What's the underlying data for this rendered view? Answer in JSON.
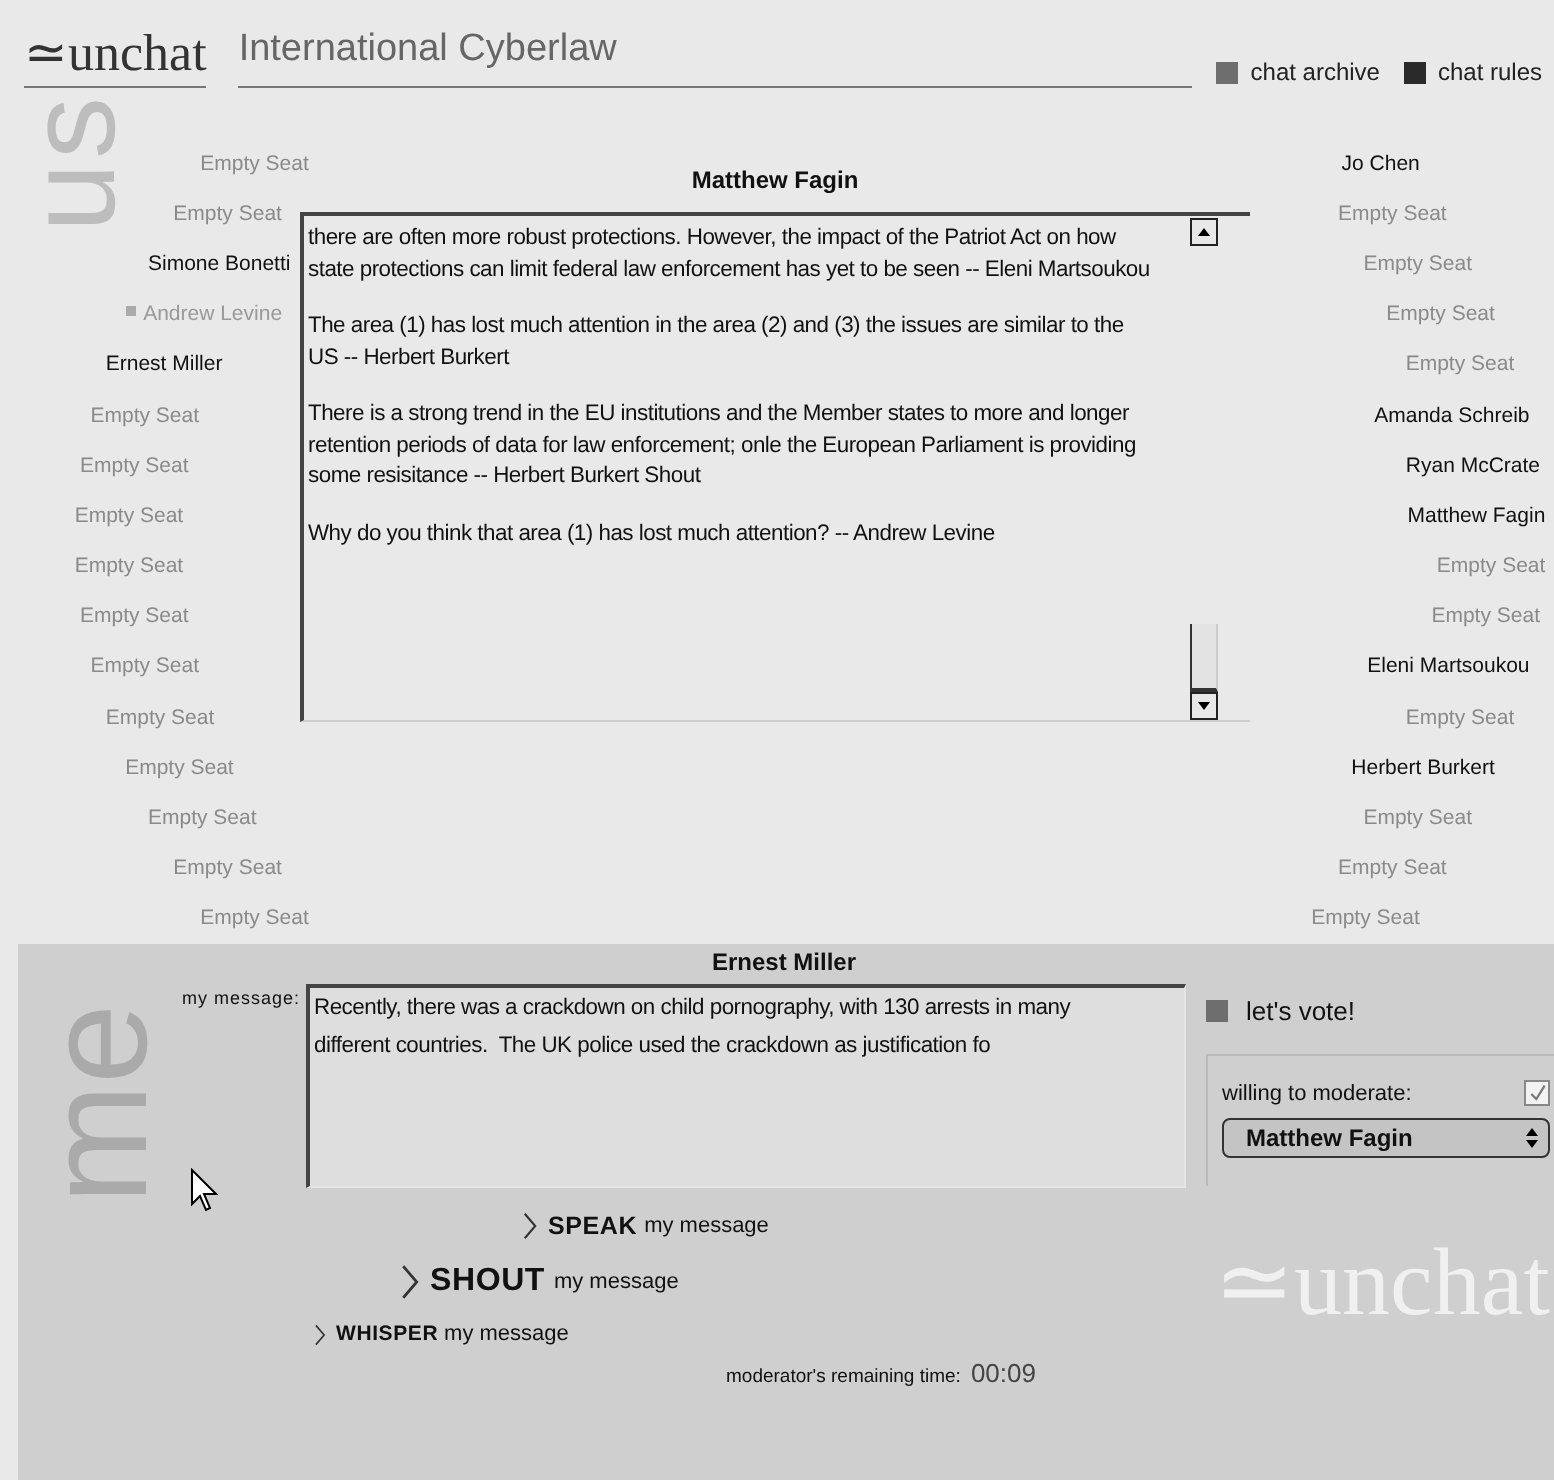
{
  "header": {
    "logo": "≃unchat",
    "room_title": "International Cyberlaw",
    "links": [
      {
        "label": "chat archive",
        "kind": "archive"
      },
      {
        "label": "chat rules",
        "kind": "rules"
      }
    ]
  },
  "side_labels": {
    "us": "us",
    "me": "me"
  },
  "left_seats": [
    {
      "name": "Empty Seat",
      "kind": "empty"
    },
    {
      "name": "Empty Seat",
      "kind": "empty"
    },
    {
      "name": "Simone Bonetti",
      "kind": "occupied"
    },
    {
      "name": "Andrew Levine",
      "kind": "idle"
    },
    {
      "name": "Ernest Miller",
      "kind": "occupied"
    },
    {
      "name": "Empty Seat",
      "kind": "empty"
    },
    {
      "name": "Empty Seat",
      "kind": "empty"
    },
    {
      "name": "Empty Seat",
      "kind": "empty"
    },
    {
      "name": "Empty Seat",
      "kind": "empty"
    },
    {
      "name": "Empty Seat",
      "kind": "empty"
    },
    {
      "name": "Empty Seat",
      "kind": "empty"
    },
    {
      "name": "Empty Seat",
      "kind": "empty"
    },
    {
      "name": "Empty Seat",
      "kind": "empty"
    },
    {
      "name": "Empty Seat",
      "kind": "empty"
    },
    {
      "name": "Empty Seat",
      "kind": "empty"
    },
    {
      "name": "Empty Seat",
      "kind": "empty"
    }
  ],
  "right_seats": [
    {
      "name": "Jo Chen",
      "kind": "occupied"
    },
    {
      "name": "Empty Seat",
      "kind": "empty"
    },
    {
      "name": "Empty Seat",
      "kind": "empty"
    },
    {
      "name": "Empty Seat",
      "kind": "empty"
    },
    {
      "name": "Empty Seat",
      "kind": "empty"
    },
    {
      "name": "Amanda Schreib",
      "kind": "occupied"
    },
    {
      "name": "Ryan McCrate",
      "kind": "occupied"
    },
    {
      "name": "Matthew Fagin",
      "kind": "occupied"
    },
    {
      "name": "Empty Seat",
      "kind": "empty"
    },
    {
      "name": "Empty Seat",
      "kind": "empty"
    },
    {
      "name": "Eleni Martsoukou",
      "kind": "occupied"
    },
    {
      "name": "Empty Seat",
      "kind": "empty"
    },
    {
      "name": "Herbert Burkert",
      "kind": "occupied"
    },
    {
      "name": "Empty Seat",
      "kind": "empty"
    },
    {
      "name": "Empty Seat",
      "kind": "empty"
    },
    {
      "name": "Empty Seat",
      "kind": "empty"
    }
  ],
  "moderator": "Matthew Fagin",
  "chat_log": [
    {
      "lines": [
        "there are often more robust protections.  However, the impact of the Patriot Act on how",
        "state protections can limit federal law enforcement has yet to be seen  -- Eleni Martsoukou"
      ]
    },
    {
      "lines": [
        "The area (1) has lost much attention in the area (2) and (3) the issues are similar to the",
        "US  -- Herbert Burkert"
      ]
    },
    {
      "lines": [
        "There is a strong trend in the EU institutions and the Member states to more and longer",
        "retention periods of data for law enforcement; onle the European Parliament is providing",
        "some resisitance   -- Herbert Burkert   Shout"
      ]
    },
    {
      "lines": [
        "Why do you think that area (1) has lost much attention?  -- Andrew Levine"
      ]
    }
  ],
  "me": {
    "name": "Ernest Miller",
    "message_label": "my message:",
    "message": "Recently, there was a crackdown on child pornography, with 130 arrests in many different countries.  The UK police used the crackdown as justification fo"
  },
  "actions": [
    {
      "kind": "speak",
      "verb": "SPEAK",
      "rest": "my message"
    },
    {
      "kind": "shout",
      "verb": "SHOUT",
      "rest": "my message"
    },
    {
      "kind": "whisper",
      "verb": "WHISPER",
      "rest": "my message"
    }
  ],
  "vote": {
    "label": "let's vote!"
  },
  "moderation": {
    "label": "willing to moderate:",
    "checked": true,
    "candidate": "Matthew Fagin"
  },
  "timer": {
    "label": "moderator's remaining time:",
    "value": "00:09"
  },
  "watermark": "≃unchat"
}
